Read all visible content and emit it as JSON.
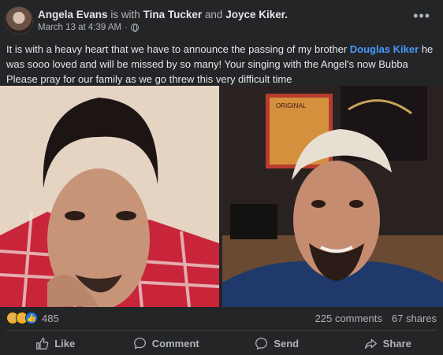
{
  "post": {
    "author": "Angela Evans",
    "with_text": "is with",
    "tagged_1": "Tina Tucker",
    "and_text": "and",
    "tagged_2": "Joyce Kiker.",
    "timestamp": "March 13 at 4:39 AM",
    "separator": "·",
    "body_before": "It is with a heavy  heart that we have to announce the passing of my brother ",
    "mention": "Douglas Kiker",
    "body_after": "  he was sooo  loved and will be missed  by so many! Your singing with the Angel's now Bubba  Please pray for our family  as we go threw this  very difficult  time",
    "more_glyph": "•••"
  },
  "photos": {
    "left_poster_text": "",
    "right_sign_text": "ORIGINAL"
  },
  "stats": {
    "reaction_count": "485",
    "comments": "225 comments",
    "shares": "67 shares"
  },
  "actions": {
    "like": "Like",
    "comment": "Comment",
    "send": "Send",
    "share": "Share"
  },
  "colors": {
    "background": "#242526",
    "text": "#e4e6eb",
    "muted": "#b0b3b8",
    "link": "#4599ff",
    "like_blue": "#1877f2"
  }
}
